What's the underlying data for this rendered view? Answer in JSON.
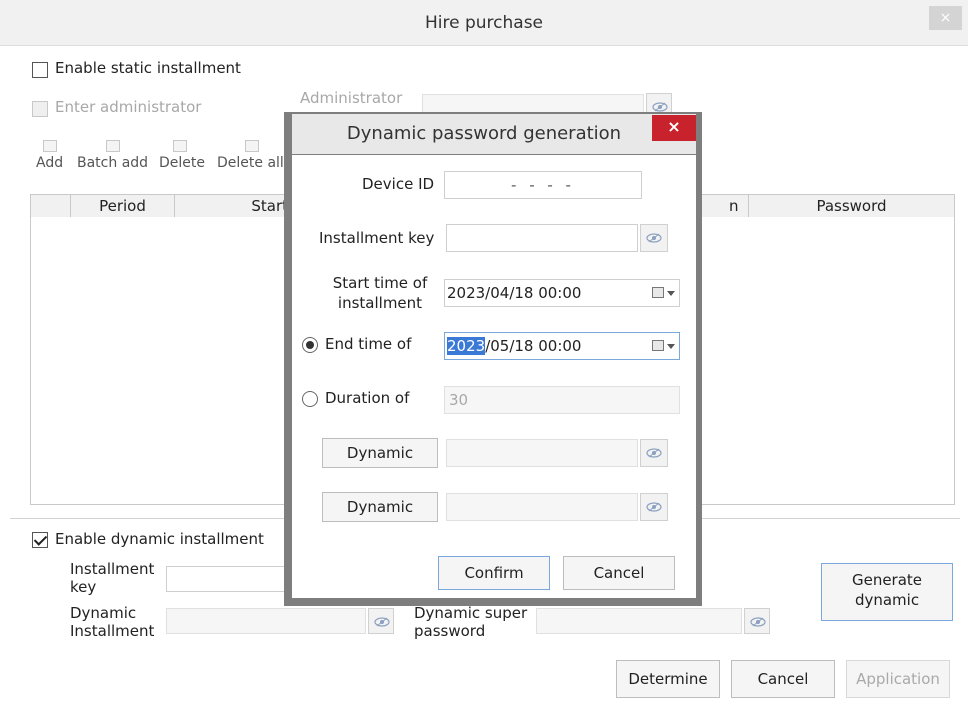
{
  "window": {
    "title": "Hire purchase",
    "close_glyph": "×"
  },
  "static_installment": {
    "enable_label": "Enable static installment",
    "enter_admin_label": "Enter administrator",
    "admin_label": "Administrator",
    "toolbar": [
      {
        "label": "Add",
        "icon": "add-icon"
      },
      {
        "label": "Batch add",
        "icon": "batch-add-icon"
      },
      {
        "label": "Delete",
        "icon": "delete-icon"
      },
      {
        "label": "Delete all",
        "icon": "delete-all-icon"
      }
    ],
    "table": {
      "columns": [
        "Period",
        "Start t",
        "n",
        "Password"
      ]
    }
  },
  "dynamic_installment": {
    "enable_label": "Enable dynamic installment",
    "enabled": true,
    "installment_key_label": "Installment key",
    "dynamic_installment_label": "Dynamic Installment",
    "dynamic_super_password_label": "Dynamic super password",
    "generate_button": "Generate dynamic"
  },
  "footer": {
    "determine": "Determine",
    "cancel": "Cancel",
    "application": "Application"
  },
  "modal": {
    "title": "Dynamic password generation",
    "close_glyph": "×",
    "device_id_label": "Device ID",
    "device_id_value": "- - - -",
    "installment_key_label": "Installment key",
    "start_time_label": "Start time of installment",
    "start_time_value": "2023/04/18 00:00",
    "end_time_label": "End time of",
    "end_time_selected": "2023",
    "end_time_rest": "/05/18 00:00",
    "end_time_checked": true,
    "duration_label": "Duration of",
    "duration_value": "30",
    "dynamic_button_1": "Dynamic",
    "dynamic_button_2": "Dynamic",
    "confirm": "Confirm",
    "cancel": "Cancel"
  },
  "colors": {
    "modal_close": "#c8232c",
    "selection": "#3a79d6",
    "primary_border": "#7aa7dc"
  }
}
